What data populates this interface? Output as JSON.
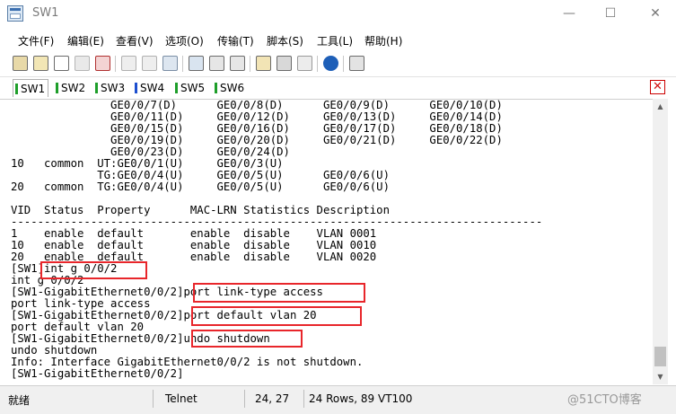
{
  "window": {
    "title": "SW1",
    "minimize_glyph": "—",
    "maximize_glyph": "☐",
    "close_glyph": "✕"
  },
  "menu": [
    {
      "label": "文件(F)"
    },
    {
      "label": "编辑(E)"
    },
    {
      "label": "查看(V)"
    },
    {
      "label": "选项(O)"
    },
    {
      "label": "传输(T)"
    },
    {
      "label": "脚本(S)"
    },
    {
      "label": "工具(L)"
    },
    {
      "label": "帮助(H)"
    }
  ],
  "toolbar_icons": [
    "connect-icon",
    "quick-connect-icon",
    "connect-tab-icon",
    "reconnect-icon",
    "disconnect-icon",
    "copy-icon",
    "paste-icon",
    "find-icon",
    "print-icon",
    "print-setup-icon",
    "print-screen-icon",
    "session-options-icon",
    "global-options-icon",
    "keymap-icon",
    "help-icon",
    "script-icon"
  ],
  "tabs": [
    {
      "label": "SW1",
      "color": "#1e9e2a",
      "active": true
    },
    {
      "label": "SW2",
      "color": "#1e9e2a",
      "active": false
    },
    {
      "label": "SW3",
      "color": "#1e9e2a",
      "active": false
    },
    {
      "label": "SW4",
      "color": "#1d4fcf",
      "active": false
    },
    {
      "label": "SW5",
      "color": "#1e9e2a",
      "active": false
    },
    {
      "label": "SW6",
      "color": "#1e9e2a",
      "active": false
    }
  ],
  "tab_close_glyph": "✕",
  "terminal_lines": [
    "               GE0/0/7(D)      GE0/0/8(D)      GE0/0/9(D)      GE0/0/10(D)",
    "               GE0/0/11(D)     GE0/0/12(D)     GE0/0/13(D)     GE0/0/14(D)",
    "               GE0/0/15(D)     GE0/0/16(D)     GE0/0/17(D)     GE0/0/18(D)",
    "               GE0/0/19(D)     GE0/0/20(D)     GE0/0/21(D)     GE0/0/22(D)",
    "               GE0/0/23(D)     GE0/0/24(D)",
    "10   common  UT:GE0/0/1(U)     GE0/0/3(U)",
    "             TG:GE0/0/4(U)     GE0/0/5(U)      GE0/0/6(U)",
    "20   common  TG:GE0/0/4(U)     GE0/0/5(U)      GE0/0/6(U)",
    "",
    "VID  Status  Property      MAC-LRN Statistics Description",
    "--------------------------------------------------------------------------------",
    "1    enable  default       enable  disable    VLAN 0001",
    "10   enable  default       enable  disable    VLAN 0010",
    "20   enable  default       enable  disable    VLAN 0020",
    "[SW1]int g 0/0/2",
    "int g 0/0/2",
    "[SW1-GigabitEthernet0/0/2]port link-type access",
    "port link-type access",
    "[SW1-GigabitEthernet0/0/2]port default vlan 20",
    "port default vlan 20",
    "[SW1-GigabitEthernet0/0/2]undo shutdown",
    "undo shutdown",
    "Info: Interface GigabitEthernet0/0/2 is not shutdown.",
    "[SW1-GigabitEthernet0/0/2]"
  ],
  "status": {
    "ready": "就绪",
    "protocol": "Telnet",
    "cursor": "24,  27",
    "rows": "24 Rows,  89",
    "emulation": "VT100"
  },
  "watermark": "@51CTO博客",
  "highlight_color": "#e8262b"
}
